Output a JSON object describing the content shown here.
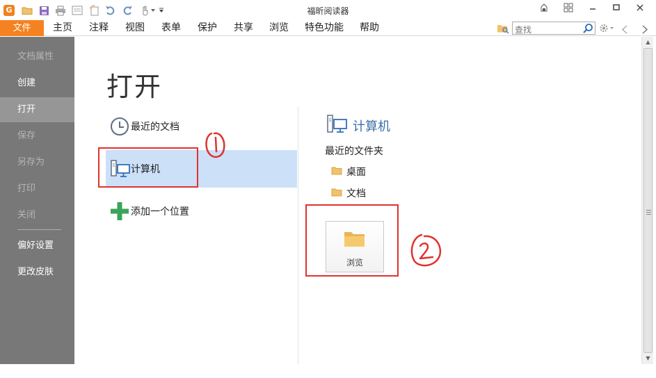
{
  "window": {
    "title": "福昕阅读器"
  },
  "quick_access": {
    "logo_letter": "G"
  },
  "menubar": {
    "file_label": "文件",
    "items": [
      "主页",
      "注释",
      "视图",
      "表单",
      "保护",
      "共享",
      "浏览",
      "特色功能",
      "帮助"
    ]
  },
  "search": {
    "placeholder": "查找"
  },
  "sidebar": {
    "items": [
      {
        "label": "文档属性",
        "state": "disabled"
      },
      {
        "label": "创建",
        "state": "enabled"
      },
      {
        "label": "打开",
        "state": "active"
      },
      {
        "label": "保存",
        "state": "disabled"
      },
      {
        "label": "另存为",
        "state": "disabled"
      },
      {
        "label": "打印",
        "state": "disabled"
      },
      {
        "label": "关闭",
        "state": "disabled"
      },
      {
        "label": "偏好设置",
        "state": "enabled"
      },
      {
        "label": "更改皮肤",
        "state": "enabled"
      }
    ]
  },
  "main": {
    "title": "打开",
    "locations": [
      {
        "label": "最近的文档",
        "icon": "clock-icon"
      },
      {
        "label": "计算机",
        "icon": "computer-icon",
        "selected": true
      },
      {
        "label": "添加一个位置",
        "icon": "plus-icon"
      }
    ],
    "right_panel": {
      "heading": "计算机",
      "recent_folders_label": "最近的文件夹",
      "folders": [
        "桌面",
        "文档"
      ],
      "browse_label": "浏览"
    }
  },
  "colors": {
    "accent_orange": "#f58220",
    "sidebar_bg": "#787878",
    "selected_bg": "#cce0f7",
    "heading_blue": "#3d6fa6",
    "annotation_red": "#e0322f",
    "folder_yellow": "#f2c26b"
  }
}
